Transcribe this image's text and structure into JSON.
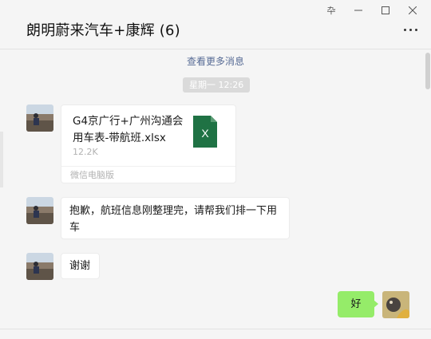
{
  "window": {
    "controls": [
      {
        "name": "pin",
        "glyph": "卆"
      },
      {
        "name": "minimize"
      },
      {
        "name": "maximize"
      },
      {
        "name": "close"
      }
    ]
  },
  "header": {
    "title": "朗明蔚来汽车+康辉 (6)",
    "more_icon": "more-dots-icon"
  },
  "messages": {
    "load_more": "查看更多消息",
    "time": "星期一 12:26",
    "items": [
      {
        "type": "file",
        "file_name": "G4京广行+广州沟通会用车表-带航班.xlsx",
        "file_size": "12.2K",
        "source": "微信电脑版",
        "icon": "excel-file-icon",
        "icon_letter": "X"
      },
      {
        "type": "text",
        "text": "抱歉，航班信息刚整理完，请帮我们排一下用车"
      },
      {
        "type": "text",
        "text": "谢谢"
      },
      {
        "type": "text",
        "from_self": true,
        "text": "好"
      }
    ]
  },
  "colors": {
    "background": "#f5f5f5",
    "link": "#576b95",
    "self_bubble": "#95ec69",
    "excel_green": "#1f7244"
  }
}
